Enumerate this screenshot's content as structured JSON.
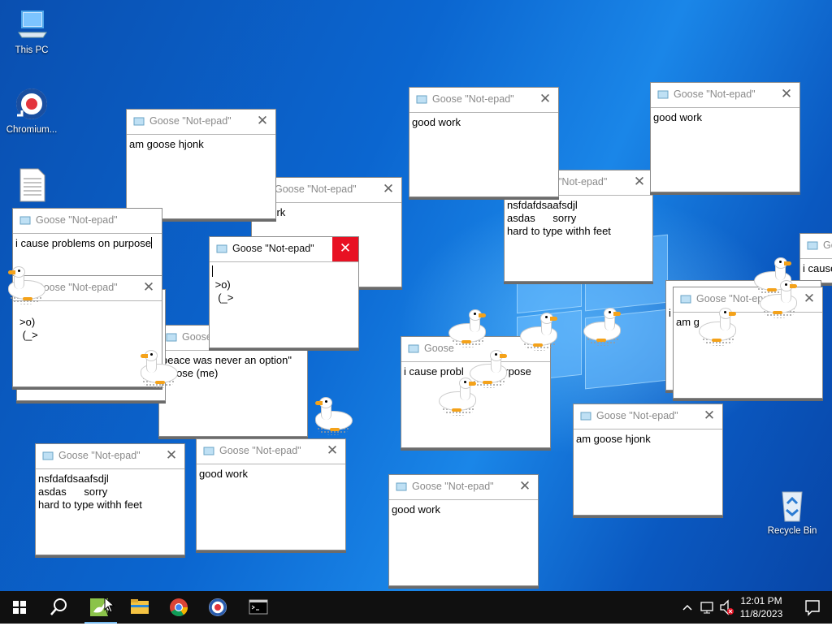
{
  "desktop": {
    "icons": [
      {
        "label": "This PC",
        "icon": "computer-icon"
      },
      {
        "label": "Chromium...",
        "icon": "chromium-icon"
      },
      {
        "label": "",
        "icon": "text-file-icon"
      },
      {
        "label": "Recycle Bin",
        "icon": "recycle-bin-icon"
      }
    ]
  },
  "note_title": "Goose \"Not-epad\"",
  "close_glyph": "✕",
  "windows": [
    {
      "text": "am goose hjonk"
    },
    {
      "text": "d work"
    },
    {
      "text": "i cause problems on purpose"
    },
    {
      "text": ">o)\n (_>"
    },
    {
      "text": "peace was never an option\"\n goose (me)"
    },
    {
      "text": "\n >o)\n  (_>"
    },
    {
      "text": "good work"
    },
    {
      "text": "good work"
    },
    {
      "text": "nsfdafdsaafsdjl\nasdas      sorry\nhard to type withh feet"
    },
    {
      "text": "i cause probl          purpose"
    },
    {
      "text": "am g"
    },
    {
      "text": "i cause"
    },
    {
      "text": "am goose hjonk"
    },
    {
      "text": "nsfdafdsaafsdjl\nasdas      sorry\nhard to type withh feet"
    },
    {
      "text": "good work"
    },
    {
      "text": "good work"
    }
  ],
  "partial_titles": {
    "w2": "Goose \"Not-epad\"",
    "w5": "Goose",
    "w9": "\"Not-epad\"",
    "w10": "Goose",
    "w11": "Goose \"Not-epad\"",
    "w12": "Go"
  },
  "taskbar": {
    "apps": [
      "start-icon",
      "search-icon",
      "goose-app-icon",
      "file-explorer-icon",
      "chrome-icon",
      "chromium-icon",
      "terminal-icon"
    ],
    "active_app": "goose-app-icon",
    "tray": [
      "chevron-up-icon",
      "network-icon",
      "volume-muted-icon",
      "notification-icon"
    ],
    "time": "12:01 PM",
    "date": "11/8/2023"
  },
  "colors": {
    "desktop_accent": "#0b66d0",
    "close_active": "#e81123",
    "goose_beak": "#f4a21a",
    "taskbar": "#101010"
  }
}
